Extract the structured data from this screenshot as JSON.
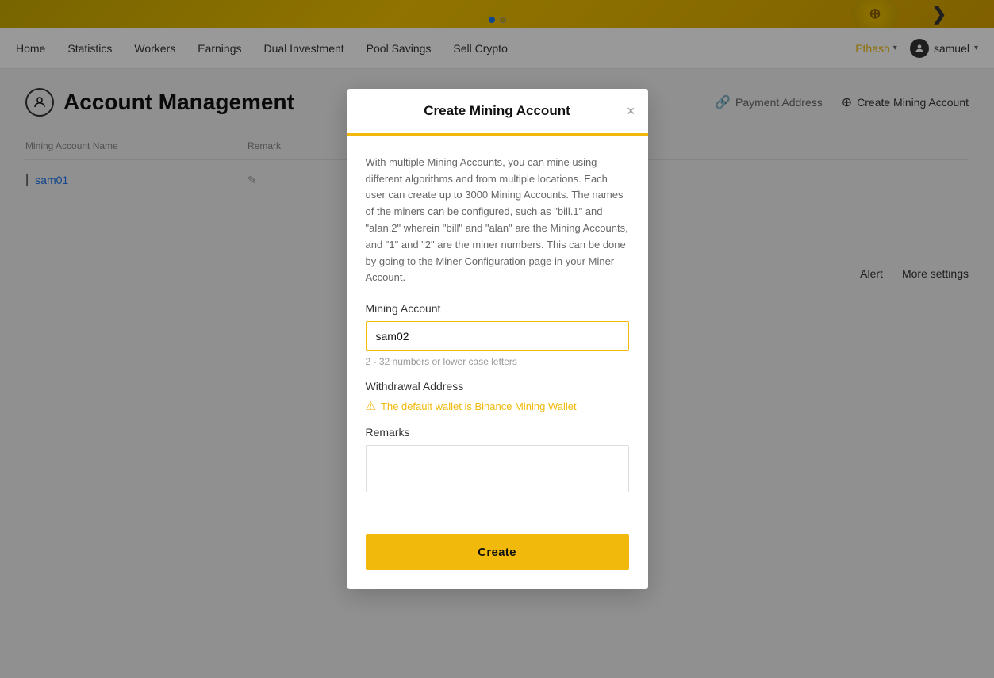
{
  "banner": {
    "dots": [
      {
        "active": true
      },
      {
        "active": false
      }
    ]
  },
  "navbar": {
    "links": [
      {
        "label": "Home",
        "id": "home"
      },
      {
        "label": "Statistics",
        "id": "statistics"
      },
      {
        "label": "Workers",
        "id": "workers"
      },
      {
        "label": "Earnings",
        "id": "earnings"
      },
      {
        "label": "Dual Investment",
        "id": "dual-investment"
      },
      {
        "label": "Pool Savings",
        "id": "pool-savings"
      },
      {
        "label": "Sell Crypto",
        "id": "sell-crypto"
      }
    ],
    "network": "Ethash",
    "user": "samuel"
  },
  "page": {
    "title": "Account Management",
    "actions": {
      "payment_address": "Payment Address",
      "create_mining_account": "Create Mining Account",
      "alert": "Alert",
      "more_settings": "More settings"
    }
  },
  "table": {
    "headers": {
      "name": "Mining Account Name",
      "remark": "Remark"
    },
    "rows": [
      {
        "name": "sam01",
        "remark": ""
      }
    ]
  },
  "modal": {
    "title": "Create Mining Account",
    "close_label": "×",
    "description": "With multiple Mining Accounts, you can mine using different algorithms and from multiple locations. Each user can create up to 3000 Mining Accounts. The names of the miners can be configured, such as \"bill.1\" and \"alan.2\" wherein \"bill\" and \"alan\" are the Mining Accounts, and \"1\" and \"2\" are the miner numbers. This can be done by going to the Miner Configuration page in your Miner Account.",
    "mining_account_label": "Mining Account",
    "mining_account_value": "sam02",
    "mining_account_hint": "2 - 32 numbers or lower case letters",
    "withdrawal_label": "Withdrawal Address",
    "withdrawal_warning": "The default wallet is Binance Mining Wallet",
    "remarks_label": "Remarks",
    "create_button": "Create"
  }
}
